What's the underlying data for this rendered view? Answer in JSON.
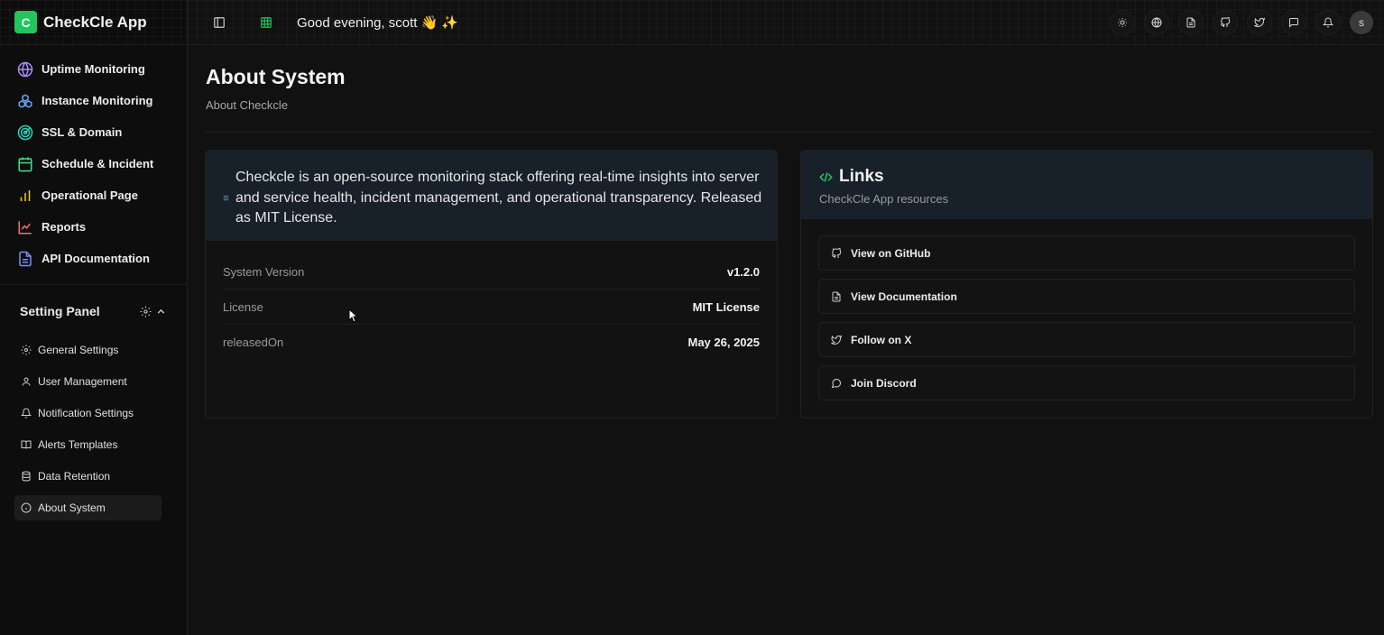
{
  "brand": {
    "logo_letter": "C",
    "name": "CheckCle App",
    "color": "#22c55e"
  },
  "nav": [
    {
      "label": "Uptime Monitoring",
      "icon": "globe-icon",
      "color": "#a78bfa"
    },
    {
      "label": "Instance Monitoring",
      "icon": "boxes-icon",
      "color": "#60a5fa"
    },
    {
      "label": "SSL & Domain",
      "icon": "radar-icon",
      "color": "#2dd4bf"
    },
    {
      "label": "Schedule & Incident",
      "icon": "calendar-icon",
      "color": "#4ade80"
    },
    {
      "label": "Operational Page",
      "icon": "bar-chart-icon",
      "color": "#facc15"
    },
    {
      "label": "Reports",
      "icon": "line-chart-icon",
      "color": "#f87171"
    },
    {
      "label": "API Documentation",
      "icon": "document-icon",
      "color": "#818cf8"
    }
  ],
  "settings_panel": {
    "title": "Setting Panel",
    "items": [
      {
        "label": "General Settings",
        "icon": "gear-icon"
      },
      {
        "label": "User Management",
        "icon": "user-icon"
      },
      {
        "label": "Notification Settings",
        "icon": "bell-icon"
      },
      {
        "label": "Alerts Templates",
        "icon": "book-icon"
      },
      {
        "label": "Data Retention",
        "icon": "database-icon"
      },
      {
        "label": "About System",
        "icon": "info-icon",
        "active": true
      }
    ]
  },
  "topbar": {
    "greeting": "Good evening, scott 👋 ✨",
    "avatar_letter": "s",
    "icons": [
      "sun-icon",
      "globe-icon",
      "document-icon",
      "github-icon",
      "twitter-icon",
      "chat-icon",
      "bell-icon"
    ]
  },
  "page": {
    "title": "About System",
    "subtitle": "About Checkcle"
  },
  "about_card": {
    "description": "Checkcle is an open-source monitoring stack offering real-time insights into server and service health, incident management, and operational transparency. Released as MIT License.",
    "rows": [
      {
        "label": "System Version",
        "value": "v1.2.0"
      },
      {
        "label": "License",
        "value": "MIT License"
      },
      {
        "label": "releasedOn",
        "value": "May 26, 2025"
      }
    ]
  },
  "links_card": {
    "title": "Links",
    "subtitle": "CheckCle App resources",
    "links": [
      {
        "label": "View on GitHub",
        "icon": "github-icon"
      },
      {
        "label": "View Documentation",
        "icon": "document-icon"
      },
      {
        "label": "Follow on X",
        "icon": "twitter-icon"
      },
      {
        "label": "Join Discord",
        "icon": "chat-icon"
      }
    ]
  }
}
